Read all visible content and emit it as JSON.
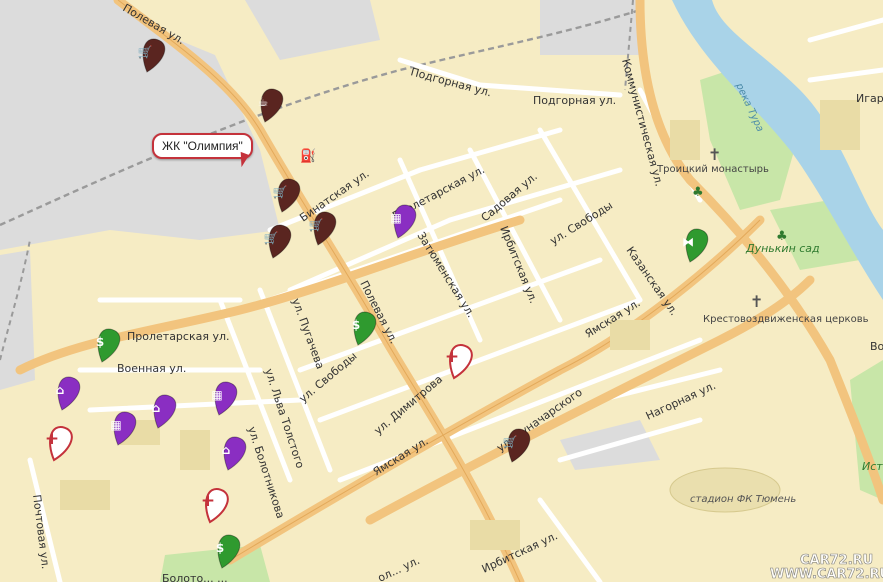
{
  "callout": {
    "label": "ЖК \"Олимпия\""
  },
  "streets": [
    "Полевая ул.",
    "Подгорная ул.",
    "Подгорная ул.",
    "Коммунистическая ул.",
    "Пролетарская ул.",
    "Садовая ул.",
    "ул. Свободы",
    "Ирбитская ул.",
    "Затюменская ул.",
    "Казанская ул.",
    "Ямская ул.",
    "Полевая ул.",
    "ул. Пугачева",
    "ул. Свободы",
    "ул. Димитрова",
    "Ямская ул.",
    "ул. Луначарского",
    "Пролетарская ул.",
    "Военная ул.",
    "ул. Льва Толстого",
    "ул. Болотникова",
    "Нагорная ул.",
    "Почтовая ул.",
    "Ирбитская ул.",
    "ол... ул.",
    "Бинатская ул.",
    "Игар"
  ],
  "pois": {
    "monastery": "Троицкий монастырь",
    "church": "Крестовоздвиженская церковь",
    "park": "Дунькин сад",
    "river": "река Тура",
    "stadium": "стадион ФК Тюмень",
    "right_edge_1": "Во",
    "right_edge_2": "Ист",
    "bottom_park": "Болото... ..."
  },
  "watermark": [
    "CAR72.RU",
    "WWW.CAR72.RU"
  ],
  "markers": [
    {
      "id": "shop-1",
      "icon": "shopping-cart-icon",
      "color": "#5a2520"
    },
    {
      "id": "cafe-1",
      "icon": "coffee-cup-icon",
      "color": "#5a2520"
    },
    {
      "id": "shop-2",
      "icon": "shopping-cart-icon",
      "color": "#5a2520"
    },
    {
      "id": "shop-3",
      "icon": "shopping-cart-icon",
      "color": "#5a2520"
    },
    {
      "id": "shop-4",
      "icon": "shopping-cart-icon",
      "color": "#5a2520"
    },
    {
      "id": "office-1",
      "icon": "office-building-icon",
      "color": "#8a2ec2"
    },
    {
      "id": "bank-1",
      "icon": "dollar-icon",
      "color": "#2f9a2f"
    },
    {
      "id": "fitness-1",
      "icon": "dumbbell-icon",
      "color": "#2f9a2f"
    },
    {
      "id": "bank-2",
      "icon": "dollar-icon",
      "color": "#2f9a2f"
    },
    {
      "id": "pharmacy-1",
      "icon": "medical-cross-icon",
      "color": "#c4323b"
    },
    {
      "id": "home-1",
      "icon": "house-icon",
      "color": "#8a2ec2"
    },
    {
      "id": "office-2",
      "icon": "office-building-icon",
      "color": "#8a2ec2"
    },
    {
      "id": "home-2",
      "icon": "house-icon",
      "color": "#8a2ec2"
    },
    {
      "id": "office-3",
      "icon": "office-building-icon",
      "color": "#8a2ec2"
    },
    {
      "id": "pharmacy-2",
      "icon": "medical-cross-icon",
      "color": "#c4323b"
    },
    {
      "id": "home-3",
      "icon": "house-icon",
      "color": "#8a2ec2"
    },
    {
      "id": "shop-5",
      "icon": "shopping-cart-icon",
      "color": "#5a2520"
    },
    {
      "id": "pharmacy-3",
      "icon": "medical-cross-icon",
      "color": "#c4323b"
    },
    {
      "id": "bank-3",
      "icon": "dollar-icon",
      "color": "#2f9a2f"
    }
  ],
  "colors": {
    "land": "#f6ecc4",
    "industrial": "#dcdcdc",
    "main_road": "#f2c47e",
    "minor_road": "#ffffff",
    "river": "#a9d3e8",
    "park": "#c8e6a8"
  }
}
